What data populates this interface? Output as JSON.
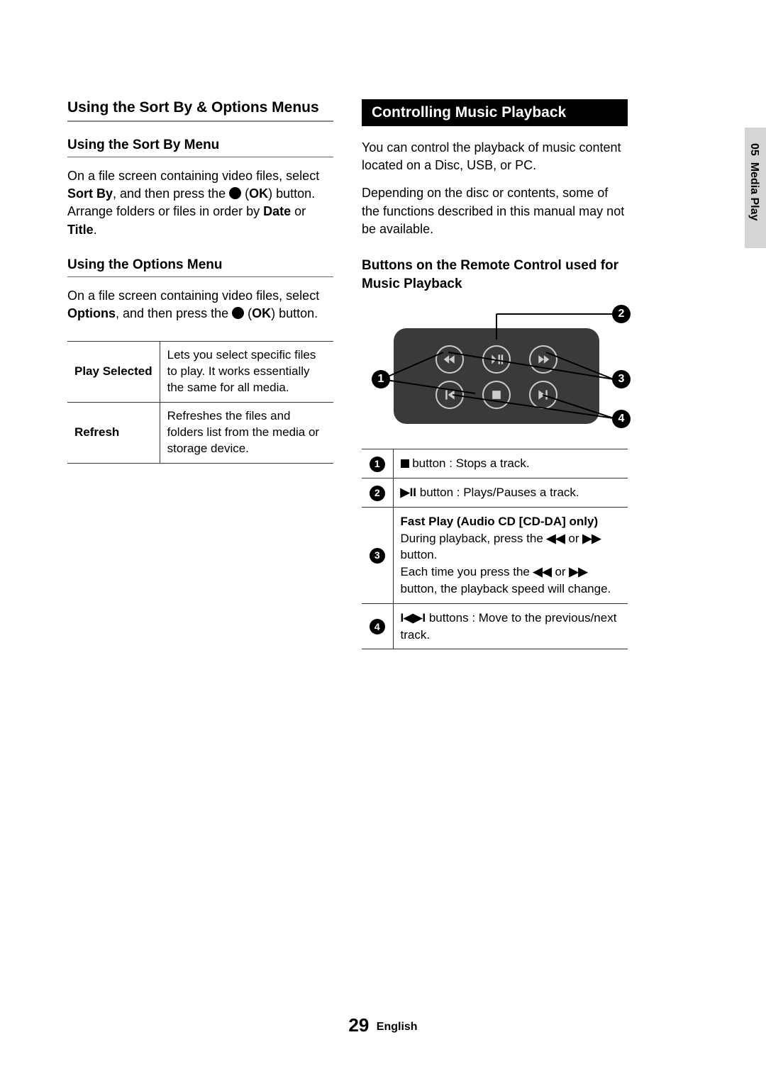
{
  "left": {
    "heading": "Using the Sort By & Options Menus",
    "sortBy": {
      "heading": "Using the Sort By Menu",
      "p1a": "On a file screen containing video files, select ",
      "p1b": "Sort By",
      "p1c": ", and then press the ",
      "p1d": " (",
      "p1e": "OK",
      "p1f": ") button. Arrange folders or files in order by ",
      "p1g": "Date",
      "p1h": " or ",
      "p1i": "Title",
      "p1j": "."
    },
    "options": {
      "heading": "Using the Options Menu",
      "p1a": "On a file screen containing video files, select ",
      "p1b": "Options",
      "p1c": ", and then press the ",
      "p1d": " (",
      "p1e": "OK",
      "p1f": ") button."
    },
    "table": {
      "r1": {
        "label": "Play Selected",
        "desc": "Lets you select specific files to play. It works essentially the same for all media."
      },
      "r2": {
        "label": "Refresh",
        "desc": "Refreshes the files and folders list from the media or storage device."
      }
    }
  },
  "right": {
    "heading": "Controlling Music Playback",
    "intro1": "You can control the playback of music content located on a Disc, USB, or PC.",
    "intro2": "Depending on the disc or contents, some of the functions described in this manual may not be available.",
    "sub": "Buttons on the Remote Control used for Music Playback",
    "callouts": {
      "n1": "1",
      "n2": "2",
      "n3": "3",
      "n4": "4"
    },
    "table": {
      "r1": {
        "n": "1",
        "text": " button : Stops a track."
      },
      "r2": {
        "n": "2",
        "text": " button : Plays/Pauses a track."
      },
      "r3": {
        "n": "3",
        "bold": "Fast Play (Audio CD [CD-DA] only)",
        "a": "During playback, press the ",
        "b": " or ",
        "c": " button.",
        "d": "Each time you press the ",
        "e": " or ",
        "f": " button, the playback speed will change."
      },
      "r4": {
        "n": "4",
        "text": "buttons : Move to the previous/next track."
      }
    }
  },
  "sideTab": {
    "chapter": "05",
    "title": "Media Play"
  },
  "footer": {
    "pageNum": "29",
    "lang": "English"
  }
}
